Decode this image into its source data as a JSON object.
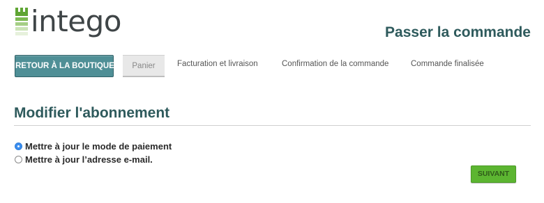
{
  "brand": {
    "logo_text": "intego",
    "logo_icon": "castle-tower-icon",
    "colors": {
      "logo_green": "#5fa533",
      "logo_text": "#3f4547"
    }
  },
  "header": {
    "title": "Passer la commande",
    "title_color": "#2e5a5c"
  },
  "nav": {
    "back_button_label": "RETOUR À LA BOUTIQUE",
    "steps": [
      {
        "label": "Panier",
        "active": true
      },
      {
        "label": "Facturation et livraison",
        "active": false
      },
      {
        "label": "Confirmation de la commande",
        "active": false
      },
      {
        "label": "Commande finalisée",
        "active": false
      }
    ],
    "colors": {
      "back_button_bg": "#4f8f96",
      "active_step_bg": "#e8e8e8"
    }
  },
  "main": {
    "section_title": "Modifier l'abonnement",
    "options": [
      {
        "label": "Mettre à jour le mode de paiement",
        "selected": true
      },
      {
        "label": "Mettre à jour l’adresse e-mail.",
        "selected": false
      }
    ],
    "next_button_label": "SUIVANT",
    "colors": {
      "next_button_bg": "#5cb531",
      "radio_selected": "#3b8ef0"
    }
  }
}
